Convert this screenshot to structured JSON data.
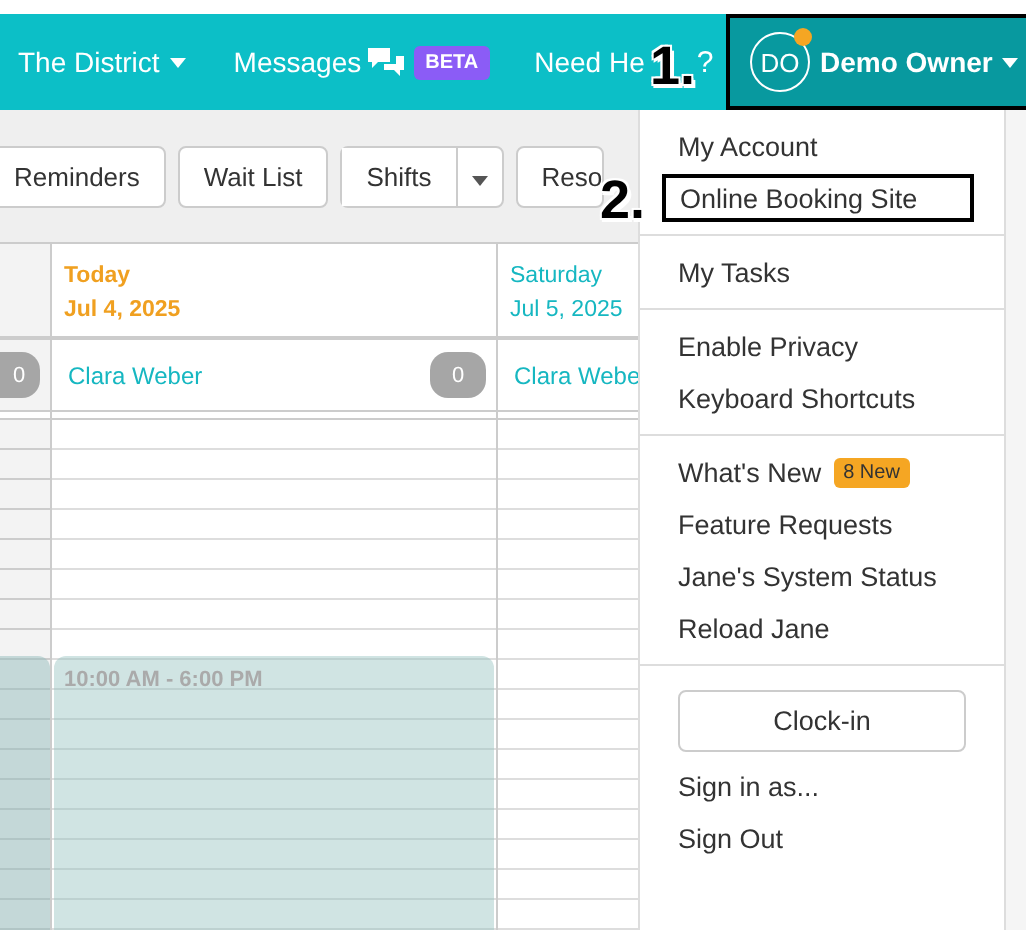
{
  "top_nav": {
    "items": [
      {
        "label": "The District",
        "kind": "dropdown"
      },
      {
        "label": "Messages",
        "kind": "messages",
        "badge": "BETA"
      },
      {
        "label": "Need He",
        "kind": "help",
        "suffix": "?"
      }
    ],
    "user": {
      "initials": "DO",
      "name": "Demo Owner",
      "notification": true,
      "selected": true
    }
  },
  "toolbar": {
    "buttons": [
      {
        "label": "Reminders",
        "kind": "button"
      },
      {
        "label": "Wait List",
        "kind": "button"
      },
      {
        "label": "Shifts",
        "kind": "split"
      },
      {
        "label": "Reso",
        "kind": "button"
      }
    ]
  },
  "calendar": {
    "left_count": "0",
    "left_shift": true,
    "days": [
      {
        "day": "Today",
        "date": "Jul 4, 2025",
        "today": true,
        "staff": "Clara Weber",
        "count": "0",
        "shift": "10:00 AM - 6:00 PM"
      },
      {
        "day": "Saturday",
        "date": "Jul 5, 2025",
        "today": false,
        "staff": "Clara Webe"
      }
    ]
  },
  "user_menu": {
    "groups": [
      [
        {
          "label": "My Account",
          "kind": "link",
          "highlighted": false
        },
        {
          "label": "Online Booking Site",
          "kind": "link",
          "highlighted": true
        }
      ],
      [
        {
          "label": "My Tasks",
          "kind": "link",
          "highlighted": false
        }
      ],
      [
        {
          "label": "Enable Privacy",
          "kind": "link",
          "highlighted": false
        },
        {
          "label": "Keyboard Shortcuts",
          "kind": "link",
          "highlighted": false
        }
      ],
      [
        {
          "label": "What's New",
          "kind": "link",
          "highlighted": false,
          "badge": "8 New"
        },
        {
          "label": "Feature Requests",
          "kind": "link",
          "highlighted": false
        },
        {
          "label": "Jane's System Status",
          "kind": "link",
          "highlighted": false
        },
        {
          "label": "Reload Jane",
          "kind": "link",
          "highlighted": false
        }
      ],
      [
        {
          "label": "Clock-in",
          "kind": "button"
        },
        {
          "label": "Sign in as...",
          "kind": "link",
          "highlighted": false
        },
        {
          "label": "Sign Out",
          "kind": "link",
          "highlighted": false
        }
      ]
    ]
  },
  "callouts": [
    {
      "label": "1."
    },
    {
      "label": "2."
    }
  ]
}
